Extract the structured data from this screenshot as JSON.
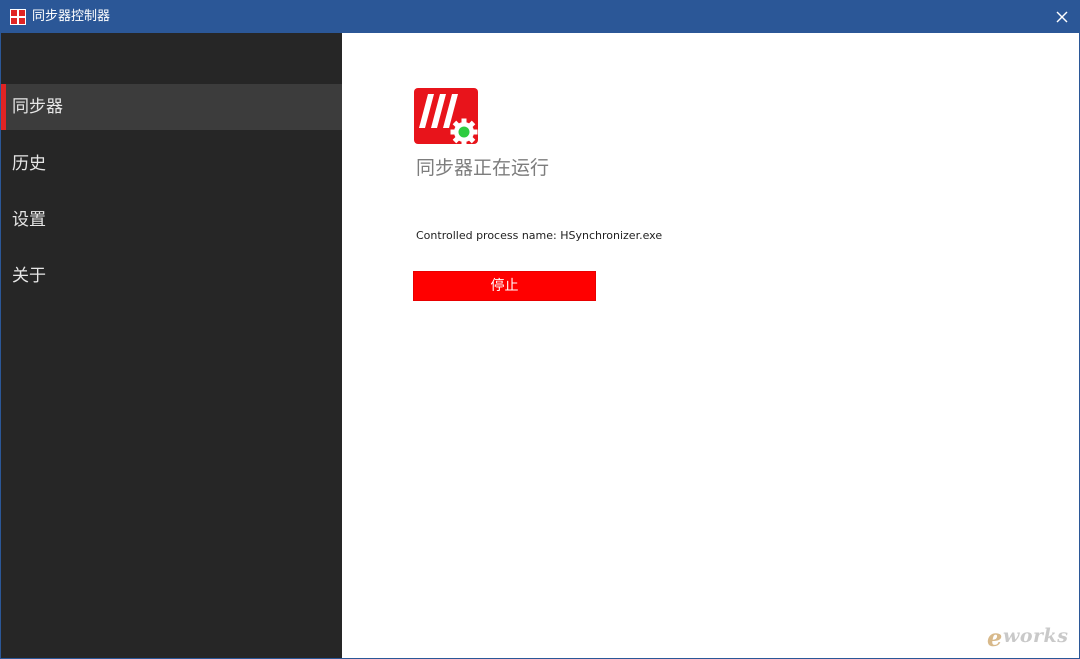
{
  "window": {
    "title": "同步器控制器",
    "titlebar_color": "#2b5797"
  },
  "sidebar": {
    "items": [
      {
        "label": "同步器",
        "active": true
      },
      {
        "label": "历史",
        "active": false
      },
      {
        "label": "设置",
        "active": false
      },
      {
        "label": "关于",
        "active": false
      }
    ]
  },
  "main": {
    "logo_icon": "synchronizer-logo-icon",
    "status_text": "同步器正在运行",
    "process_label": "Controlled process name: HSynchronizer.exe",
    "stop_button_label": "停止",
    "accent_color": "#ff0000",
    "status_indicator_color": "#2ecc40"
  },
  "watermark": {
    "prefix": "e",
    "text": "works"
  }
}
